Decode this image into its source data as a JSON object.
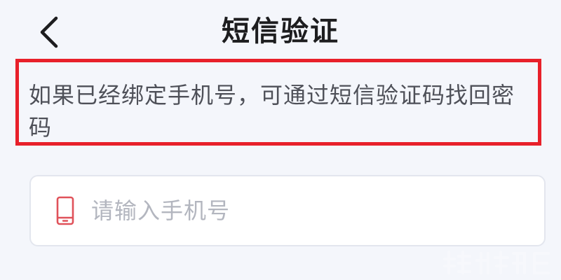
{
  "header": {
    "back_icon": "chevron-left-icon",
    "title": "短信验证"
  },
  "hint": {
    "text": "如果已经绑定手机号，可通过短信验证码找回密码",
    "highlight_color": "#e8202a"
  },
  "phone_field": {
    "icon": "mobile-phone-icon",
    "icon_color": "#e0525a",
    "placeholder": "请输入手机号",
    "value": ""
  },
  "colors": {
    "background": "#f4f6fb",
    "title": "#1d1d1f",
    "hint_text": "#4e5058",
    "placeholder": "#b3b6bf"
  }
}
